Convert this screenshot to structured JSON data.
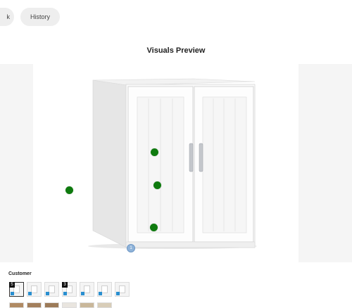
{
  "nav": {
    "back_label": "k",
    "history_label": "History"
  },
  "preview": {
    "title": "Visuals Preview",
    "marker_number": "1"
  },
  "customer": {
    "label": "Customer",
    "thumbnails": [
      {
        "number": "5",
        "selected": true
      },
      {
        "number": "",
        "selected": false
      },
      {
        "number": "",
        "selected": false
      },
      {
        "number": "3",
        "selected": false
      },
      {
        "number": "",
        "selected": false
      },
      {
        "number": "",
        "selected": false
      },
      {
        "number": "",
        "selected": false
      }
    ],
    "second_row_colors": [
      "#b08a63",
      "#a37f5c",
      "#9c7a58",
      "#e9e5df",
      "#c9b79a",
      "#d8cdb8"
    ]
  },
  "colors": {
    "marker": "#0e7a0e",
    "numbered_marker": "#8fb3d9",
    "badge": "#2a8fd0"
  }
}
